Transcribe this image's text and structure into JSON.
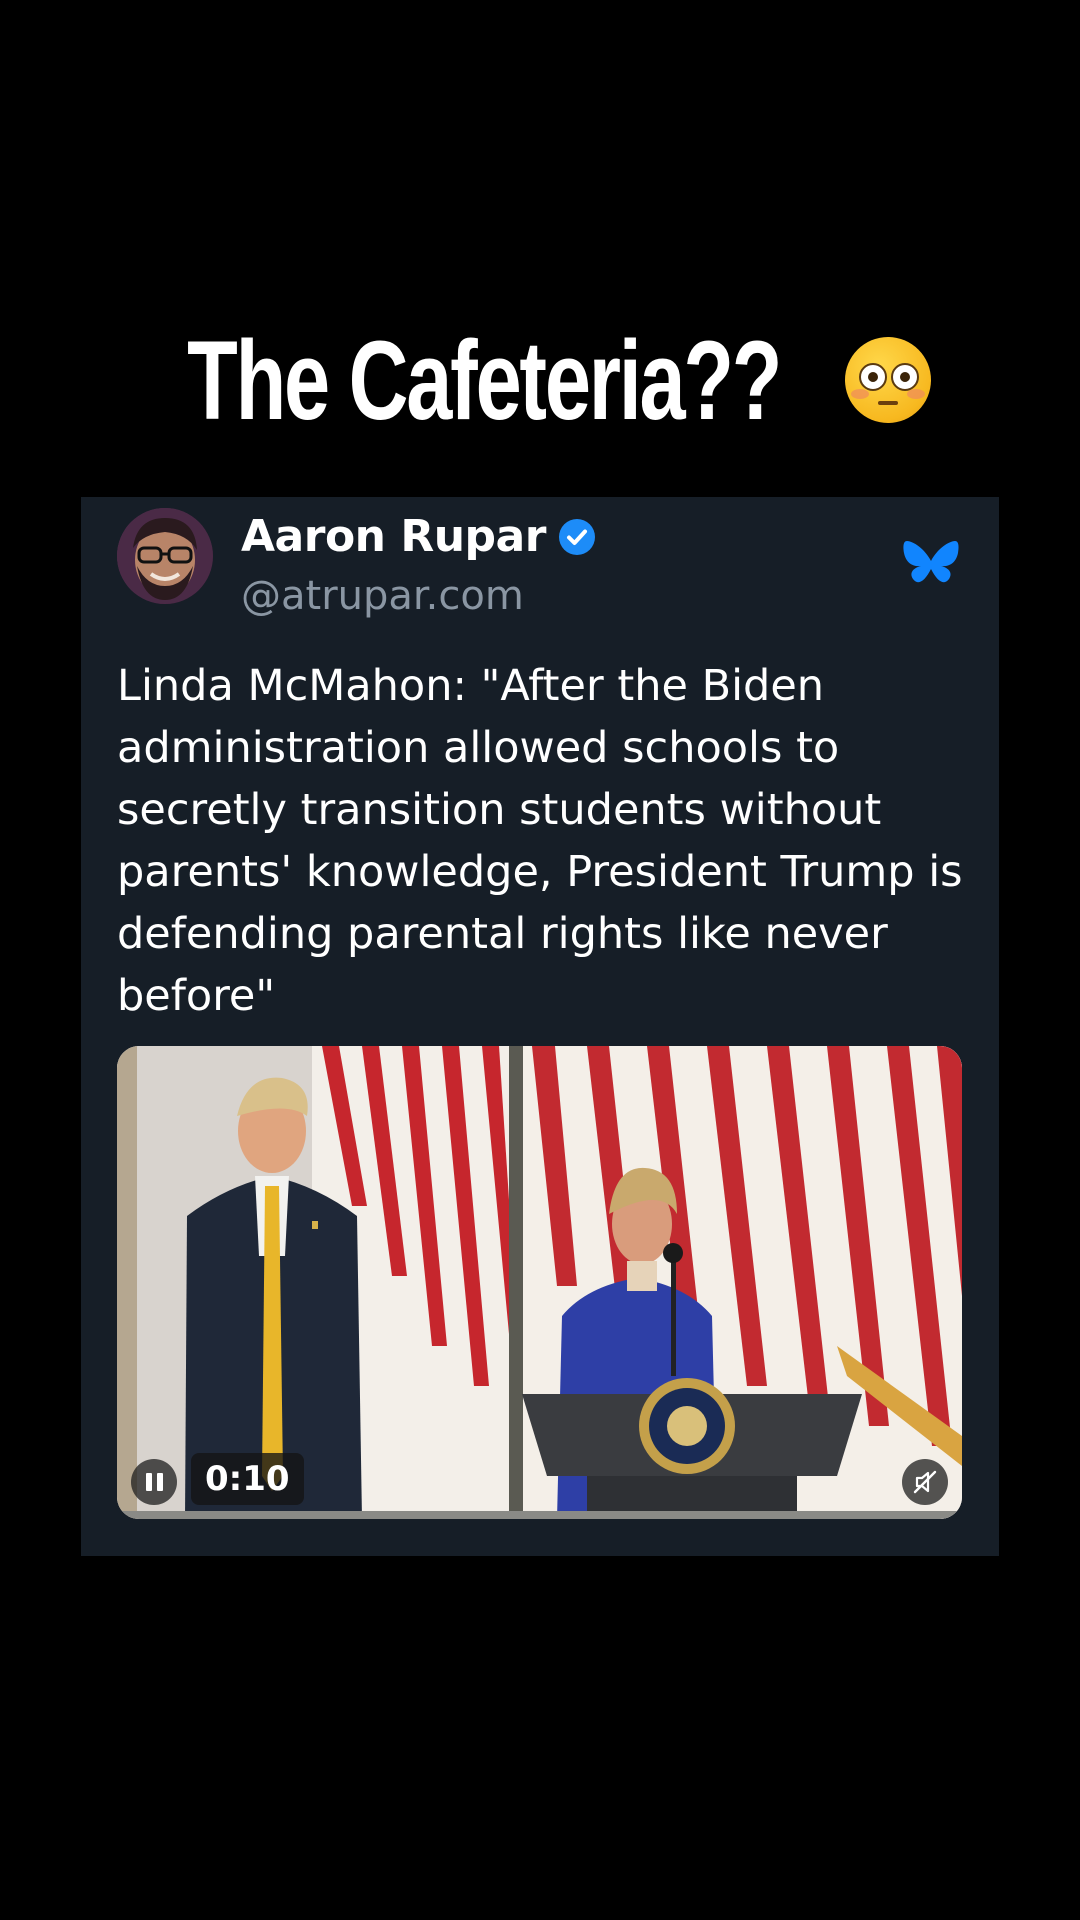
{
  "headline": {
    "text": "The Cafeteria??",
    "emoji_icon": "flushed-face-icon"
  },
  "post": {
    "author_name": "Aaron Rupar",
    "author_handle": "@atrupar.com",
    "verified_icon": "verified-check-icon",
    "platform_icon": "bluesky-butterfly-icon",
    "text": "Linda McMahon: \"After the Biden administration allowed schools to secretly transition students without parents' knowledge, President Trump is defending parental rights like never before\"",
    "video": {
      "elapsed_time": "0:10",
      "pause_icon": "pause-icon",
      "mute_icon": "muted-speaker-icon"
    }
  },
  "colors": {
    "background": "#000000",
    "card": "#161e27",
    "handle": "#8a96a3",
    "verified": "#1d8cf8",
    "bluesky": "#1185fe"
  }
}
